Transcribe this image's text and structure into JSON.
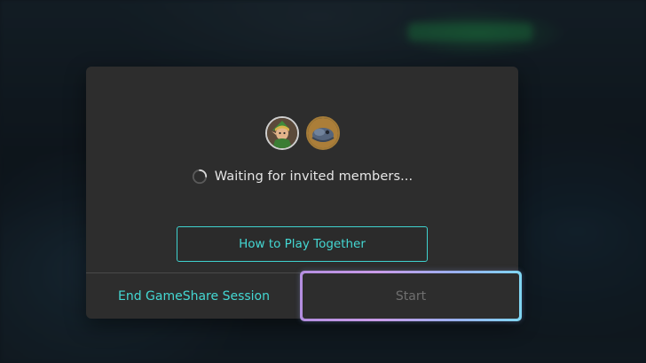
{
  "background": {
    "accent_color": "#1f8f4e"
  },
  "dialog": {
    "avatars": [
      {
        "icon": "elf-character-avatar-icon",
        "role": "host"
      },
      {
        "icon": "creature-avatar-icon",
        "role": "invited"
      }
    ],
    "status": {
      "icon": "loading-spinner-icon",
      "text": "Waiting for invited members..."
    },
    "how_to_play_label": "How to Play Together",
    "end_session_label": "End GameShare Session",
    "start_label": "Start"
  },
  "colors": {
    "accent_teal": "#44d8d3",
    "dialog_bg": "#2d2d2d",
    "disabled_text": "#6f6f6f",
    "focus_gradient_start": "#b48ee0",
    "focus_gradient_end": "#7fd6f2"
  }
}
